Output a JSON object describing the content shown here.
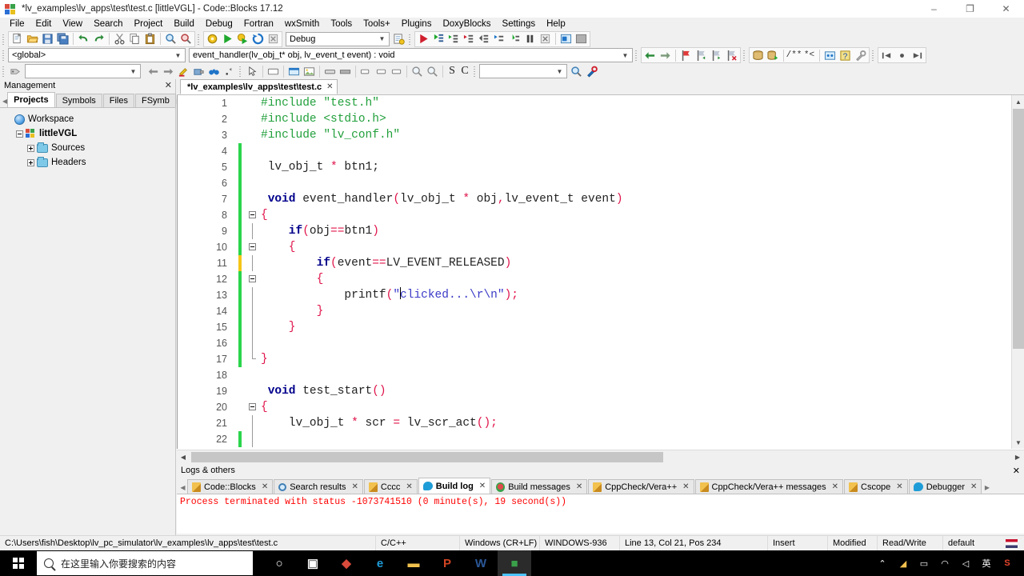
{
  "window": {
    "title": "*lv_examples\\lv_apps\\test\\test.c [littleVGL] - Code::Blocks 17.12",
    "app_icon": "codeblocks-icon",
    "minimize": "–",
    "maximize": "❐",
    "close": "✕"
  },
  "menubar": {
    "items": [
      {
        "label": "File"
      },
      {
        "label": "Edit"
      },
      {
        "label": "View"
      },
      {
        "label": "Search"
      },
      {
        "label": "Project"
      },
      {
        "label": "Build"
      },
      {
        "label": "Debug"
      },
      {
        "label": "Fortran"
      },
      {
        "label": "wxSmith"
      },
      {
        "label": "Tools"
      },
      {
        "label": "Tools+"
      },
      {
        "label": "Plugins"
      },
      {
        "label": "DoxyBlocks"
      },
      {
        "label": "Settings"
      },
      {
        "label": "Help"
      }
    ]
  },
  "toolbar_main": {
    "groups": [
      {
        "icons": [
          "new-file-icon",
          "open-file-icon",
          "save-icon",
          "save-all-icon"
        ]
      },
      {
        "icons": [
          "undo-icon",
          "redo-icon"
        ]
      },
      {
        "icons": [
          "cut-icon",
          "copy-icon",
          "paste-icon"
        ]
      },
      {
        "icons": [
          "find-icon",
          "replace-icon"
        ]
      }
    ],
    "build_group": {
      "icons": [
        "build-icon",
        "run-icon",
        "build-and-run-icon",
        "rebuild-icon",
        "abort-icon"
      ]
    },
    "build_target": {
      "value": "Debug",
      "label": "build-target-combo"
    },
    "target_options_icon": "build-target-options-icon",
    "debug_group": {
      "icons": [
        "debug-continue-icon",
        "debug-run-to-cursor-icon",
        "debug-next-line-icon",
        "debug-step-into-icon",
        "debug-step-out-icon",
        "debug-next-instruction-icon",
        "debug-step-into-instruction-icon",
        "debug-break-icon",
        "debug-stop-icon"
      ]
    },
    "debug_windows": {
      "icons": [
        "debugging-windows-icon",
        "various-info-icon"
      ]
    }
  },
  "toolbar_symbols": {
    "scope": {
      "value": "<global>"
    },
    "function": {
      "value": "event_handler(lv_obj_t* obj, lv_event_t event) : void"
    },
    "nav_icons": [
      "back-icon",
      "forward-icon"
    ],
    "bookmark_icons": [
      "toggle-bookmark-icon",
      "previous-bookmark-icon",
      "next-bookmark-icon",
      "clear-bookmarks-icon"
    ],
    "doc_icons": [
      "doxyblocks-run-icon",
      "doxyblocks-extract-icon"
    ],
    "comment_icons": [
      "block-comment-icon",
      "stream-comment-icon"
    ],
    "misc_icons": [
      "doxywizard-icon",
      "help-icon",
      "doxyblocks-config-icon"
    ],
    "browse_icons": [
      "browse-back-icon",
      "browse-mark-icon",
      "browse-forward-icon"
    ]
  },
  "toolbar_wxsmith": {
    "dropdown_value": "",
    "icons_left": [
      "resource-icon",
      "prev-icon",
      "next-icon",
      "highlight-icon",
      "place-icon",
      "search-binoculars-icon",
      "quick-icon"
    ],
    "icons_mid": [
      "pointer-icon",
      "panel-icon",
      "dialog-icon",
      "frame-icon",
      "image-icon"
    ],
    "icons_right": [
      "button-icon",
      "textctrl-icon",
      "combo-icon",
      "zoom-in-icon",
      "zoom-out-icon"
    ],
    "letters": [
      "S",
      "C"
    ],
    "search_value": "",
    "search_icons": [
      "search-go-icon",
      "search-options-icon"
    ]
  },
  "management": {
    "title": "Management",
    "close_icon": "close-icon",
    "prev_tab_icon": "scroll-left-icon",
    "next_tab_icon": "scroll-right-icon",
    "tabs": [
      {
        "label": "Projects",
        "active": true
      },
      {
        "label": "Symbols",
        "active": false
      },
      {
        "label": "Files",
        "active": false
      },
      {
        "label": "FSymb",
        "active": false
      }
    ],
    "tree": [
      {
        "label": "Workspace",
        "icon": "workspace-icon",
        "indent": 0,
        "expander": "none",
        "bold": false
      },
      {
        "label": "littleVGL",
        "icon": "project-icon",
        "indent": 1,
        "expander": "minus",
        "bold": true
      },
      {
        "label": "Sources",
        "icon": "folder-icon",
        "indent": 2,
        "expander": "plus",
        "bold": false
      },
      {
        "label": "Headers",
        "icon": "folder-icon",
        "indent": 2,
        "expander": "plus",
        "bold": false
      }
    ]
  },
  "editor": {
    "tab": {
      "label": "*lv_examples\\lv_apps\\test\\test.c",
      "close": "✕"
    },
    "lines": [
      {
        "n": "1",
        "mark": "none",
        "fold": "none",
        "segs": [
          {
            "t": "#include ",
            "c": "pre"
          },
          {
            "t": "\"test.h\"",
            "c": "pre"
          }
        ]
      },
      {
        "n": "2",
        "mark": "none",
        "fold": "none",
        "segs": [
          {
            "t": "#include ",
            "c": "pre"
          },
          {
            "t": "<stdio.h>",
            "c": "pre"
          }
        ]
      },
      {
        "n": "3",
        "mark": "none",
        "fold": "none",
        "segs": [
          {
            "t": "#include ",
            "c": "pre"
          },
          {
            "t": "\"lv_conf.h\"",
            "c": "pre"
          }
        ]
      },
      {
        "n": "4",
        "mark": "saved",
        "fold": "none",
        "segs": []
      },
      {
        "n": "5",
        "mark": "saved",
        "fold": "none",
        "segs": [
          {
            "t": " lv_obj_t ",
            "c": "pl"
          },
          {
            "t": "*",
            "c": "op"
          },
          {
            "t": " btn1;",
            "c": "pl"
          }
        ]
      },
      {
        "n": "6",
        "mark": "saved",
        "fold": "none",
        "segs": []
      },
      {
        "n": "7",
        "mark": "saved",
        "fold": "none",
        "segs": [
          {
            "t": " void",
            "c": "kw"
          },
          {
            "t": " event_handler",
            "c": "pl"
          },
          {
            "t": "(",
            "c": "op"
          },
          {
            "t": "lv_obj_t ",
            "c": "pl"
          },
          {
            "t": "*",
            "c": "op"
          },
          {
            "t": " obj",
            "c": "pl"
          },
          {
            "t": ",",
            "c": "op"
          },
          {
            "t": "lv_event_t event",
            "c": "pl"
          },
          {
            "t": ")",
            "c": "op"
          }
        ]
      },
      {
        "n": "8",
        "mark": "saved",
        "fold": "box",
        "segs": [
          {
            "t": "{",
            "c": "op"
          }
        ]
      },
      {
        "n": "9",
        "mark": "saved",
        "fold": "line",
        "segs": [
          {
            "t": "    if",
            "c": "kw"
          },
          {
            "t": "(",
            "c": "op"
          },
          {
            "t": "obj",
            "c": "pl"
          },
          {
            "t": "==",
            "c": "op"
          },
          {
            "t": "btn1",
            "c": "pl"
          },
          {
            "t": ")",
            "c": "op"
          }
        ]
      },
      {
        "n": "10",
        "mark": "saved",
        "fold": "box2",
        "segs": [
          {
            "t": "    {",
            "c": "op"
          }
        ]
      },
      {
        "n": "11",
        "mark": "unsaved",
        "fold": "line2",
        "segs": [
          {
            "t": "        if",
            "c": "kw"
          },
          {
            "t": "(",
            "c": "op"
          },
          {
            "t": "event",
            "c": "pl"
          },
          {
            "t": "==",
            "c": "op"
          },
          {
            "t": "LV_EVENT_RELEASED",
            "c": "pl"
          },
          {
            "t": ")",
            "c": "op"
          }
        ]
      },
      {
        "n": "12",
        "mark": "saved",
        "fold": "box3",
        "segs": [
          {
            "t": "        {",
            "c": "op"
          }
        ]
      },
      {
        "n": "13",
        "mark": "saved",
        "fold": "line3",
        "segs": [
          {
            "t": "            printf",
            "c": "pl"
          },
          {
            "t": "(",
            "c": "op"
          },
          {
            "t": "\"",
            "c": "str"
          },
          {
            "t": "CARET",
            "c": "caret"
          },
          {
            "t": "clicked...\\r\\n\"",
            "c": "str"
          },
          {
            "t": ")",
            "c": "op"
          },
          {
            "t": ";",
            "c": "op"
          }
        ]
      },
      {
        "n": "14",
        "mark": "saved",
        "fold": "line3",
        "segs": [
          {
            "t": "        }",
            "c": "op"
          }
        ]
      },
      {
        "n": "15",
        "mark": "saved",
        "fold": "line2",
        "segs": [
          {
            "t": "    }",
            "c": "op"
          }
        ]
      },
      {
        "n": "16",
        "mark": "saved",
        "fold": "line",
        "segs": []
      },
      {
        "n": "17",
        "mark": "saved",
        "fold": "endl",
        "segs": [
          {
            "t": "}",
            "c": "op"
          }
        ]
      },
      {
        "n": "18",
        "mark": "none",
        "fold": "none",
        "segs": []
      },
      {
        "n": "19",
        "mark": "none",
        "fold": "none",
        "segs": [
          {
            "t": " void",
            "c": "kw"
          },
          {
            "t": " test_start",
            "c": "pl"
          },
          {
            "t": "()",
            "c": "op"
          }
        ]
      },
      {
        "n": "20",
        "mark": "none",
        "fold": "box",
        "segs": [
          {
            "t": "{",
            "c": "op"
          }
        ]
      },
      {
        "n": "21",
        "mark": "none",
        "fold": "line",
        "segs": [
          {
            "t": "    lv_obj_t ",
            "c": "pl"
          },
          {
            "t": "*",
            "c": "op"
          },
          {
            "t": " scr ",
            "c": "pl"
          },
          {
            "t": "=",
            "c": "op"
          },
          {
            "t": " lv_scr_act",
            "c": "pl"
          },
          {
            "t": "()",
            "c": "op"
          },
          {
            "t": ";",
            "c": "op"
          }
        ]
      },
      {
        "n": "22",
        "mark": "saved",
        "fold": "line",
        "segs": []
      }
    ],
    "scroll_up_icon": "▲",
    "scroll_down_icon": "▼",
    "scroll_left_icon": "◀",
    "scroll_right_icon": "▶"
  },
  "logs": {
    "title": "Logs & others",
    "close_icon": "✕",
    "prev_icon": "◀",
    "next_icon": "▶",
    "tabs": [
      {
        "label": "Code::Blocks",
        "icon": "pencil",
        "active": false
      },
      {
        "label": "Search results",
        "icon": "magnify",
        "active": false
      },
      {
        "label": "Cccc",
        "icon": "pencil",
        "active": false
      },
      {
        "label": "Build log",
        "icon": "bubble",
        "active": true
      },
      {
        "label": "Build messages",
        "icon": "flower",
        "active": false
      },
      {
        "label": "CppCheck/Vera++",
        "icon": "pencil",
        "active": false
      },
      {
        "label": "CppCheck/Vera++ messages",
        "icon": "pencil",
        "active": false
      },
      {
        "label": "Cscope",
        "icon": "pencil",
        "active": false
      },
      {
        "label": "Debugger",
        "icon": "bubble",
        "active": false
      }
    ],
    "message": "Process terminated with status -1073741510 (0 minute(s), 19 second(s))"
  },
  "statusbar": {
    "path": "C:\\Users\\fish\\Desktop\\lv_pc_simulator\\lv_examples\\lv_apps\\test\\test.c",
    "language": "C/C++",
    "eol": "Windows (CR+LF)",
    "encoding": "WINDOWS-936",
    "position": "Line 13, Col 21, Pos 234",
    "insert_mode": "Insert",
    "modified": "Modified",
    "permission": "Read/Write",
    "personality": "default",
    "flag_icon": "us-flag-icon"
  },
  "taskbar": {
    "start_icon": "windows-start-icon",
    "search_placeholder": "在这里输入你要搜索的内容",
    "search_icon": "search-icon",
    "apps": [
      {
        "name": "cortana-icon",
        "glyph": "○",
        "color": "#ffffff",
        "active": false
      },
      {
        "name": "task-view-icon",
        "glyph": "▣",
        "color": "#ffffff",
        "active": false
      },
      {
        "name": "pdf-reader-icon",
        "glyph": "◆",
        "color": "#d94b3b",
        "active": false
      },
      {
        "name": "edge-icon",
        "glyph": "e",
        "color": "#1e9cd7",
        "active": false
      },
      {
        "name": "file-explorer-icon",
        "glyph": "▬",
        "color": "#f2c14e",
        "active": false
      },
      {
        "name": "powerpoint-icon",
        "glyph": "P",
        "color": "#d04423",
        "active": false
      },
      {
        "name": "word-icon",
        "glyph": "W",
        "color": "#2b5797",
        "active": false
      },
      {
        "name": "codeblocks-taskbar-icon",
        "glyph": "■",
        "color": "#3aa14a",
        "active": true
      }
    ],
    "tray": [
      {
        "name": "show-hidden-icons",
        "glyph": "⌃"
      },
      {
        "name": "safely-remove-hardware-icon",
        "glyph": "◢"
      },
      {
        "name": "battery-icon",
        "glyph": "▭"
      },
      {
        "name": "wifi-icon",
        "glyph": "◠"
      },
      {
        "name": "volume-icon",
        "glyph": "◁"
      },
      {
        "name": "ime-language-icon",
        "glyph": "英"
      },
      {
        "name": "sogou-input-icon",
        "glyph": "S"
      }
    ]
  }
}
